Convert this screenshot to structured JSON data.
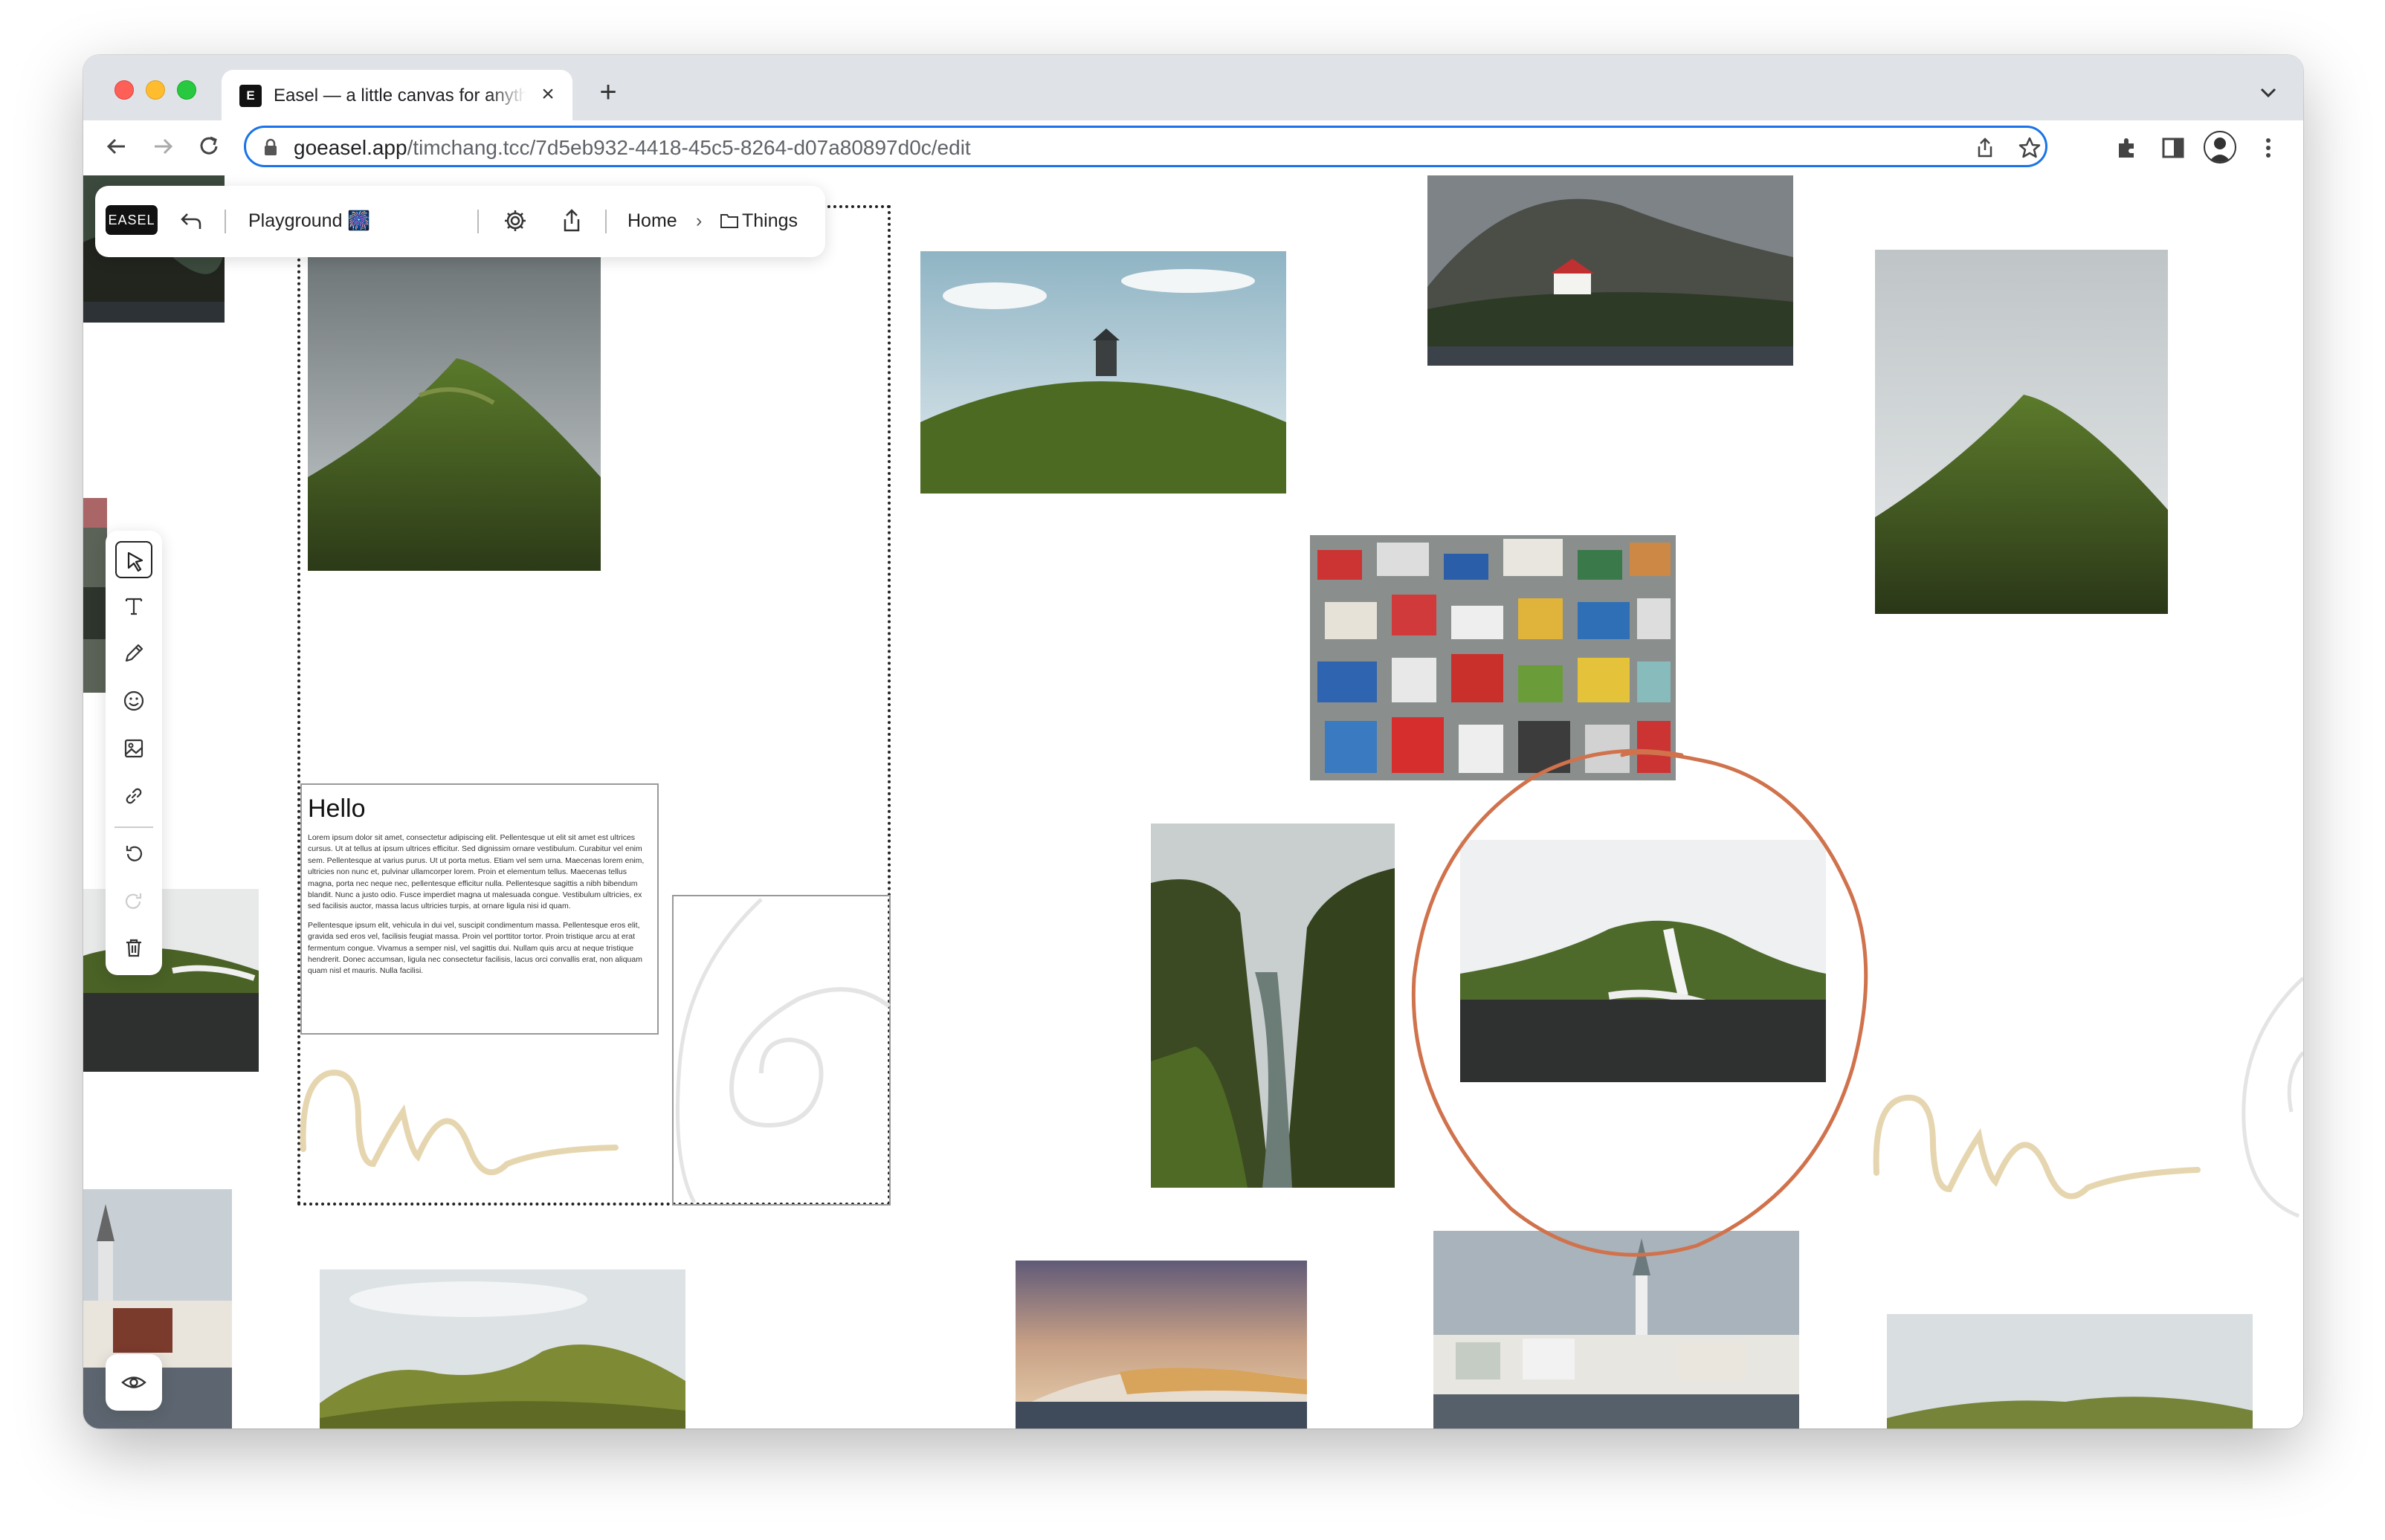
{
  "browser": {
    "tab_favicon": "E",
    "tab_title": "Easel — a little canvas for anything",
    "url_host": "goeasel.app",
    "url_path": "/timchang.tcc/7d5eb932-4418-45c5-8264-d07a80897d0c/edit"
  },
  "app": {
    "logo": "EASEL",
    "board_name": "Playground 🎆",
    "breadcrumb": {
      "home": "Home",
      "separator": "›",
      "folder": "Things"
    }
  },
  "text_card": {
    "heading": "Hello",
    "paragraph1": "Lorem ipsum dolor sit amet, consectetur adipiscing elit. Pellentesque ut elit sit amet est ultrices cursus. Ut at tellus at ipsum ultrices efficitur. Sed dignissim ornare vestibulum. Curabitur vel enim sem. Pellentesque at varius purus. Ut ut porta metus. Etiam vel sem urna. Maecenas lorem enim, ultricies non nunc et, pulvinar ullamcorper lorem. Proin et elementum tellus. Maecenas tellus magna, porta nec neque nec, pellentesque efficitur nulla. Pellentesque sagittis a nibh bibendum blandit. Nunc a justo odio. Fusce imperdiet magna ut malesuada congue. Vestibulum ultricies, ex sed facilisis auctor, massa lacus ultricies turpis, at ornare ligula nisi id quam.",
    "paragraph2": "Pellentesque ipsum elit, vehicula in dui vel, suscipit condimentum massa. Pellentesque eros elit, gravida sed eros vel, facilisis feugiat massa. Proin vel porttitor tortor. Proin tristique arcu at erat fermentum congue. Vivamus a semper nisl, vel sagittis dui. Nullam quis arcu at neque tristique hendrerit. Donec accumsan, ligula nec consectetur facilisis, lacus orci convallis erat, non aliquam quam nisl et mauris. Nulla facilisi."
  },
  "colors": {
    "accent_circle": "#d0724c",
    "scribble": "#e6d6b0",
    "omnibox_focus": "#1a73e8"
  },
  "icons": {
    "tools": [
      "select-cursor-icon",
      "text-tool-icon",
      "pencil-icon",
      "emoji-icon",
      "image-icon",
      "link-icon",
      "undo-icon",
      "redo-icon",
      "trash-icon"
    ],
    "preview": "eye-icon"
  }
}
